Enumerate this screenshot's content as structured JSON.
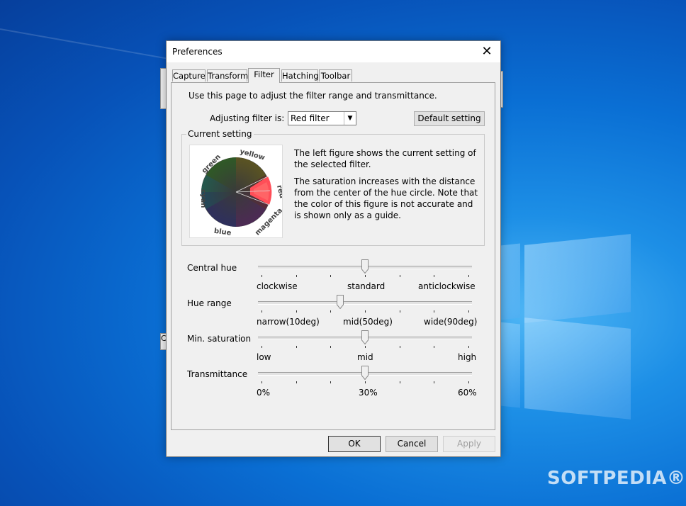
{
  "dialog": {
    "title": "Preferences",
    "close_glyph": "✕",
    "tabs": [
      "Capture",
      "Transform",
      "Filter",
      "Hatching",
      "Toolbar"
    ],
    "active_tab": "Filter"
  },
  "filter_page": {
    "intro": "Use this page to adjust the filter range and transmittance.",
    "adjusting_label": "Adjusting filter is:",
    "adjusting_value": "Red filter",
    "default_button": "Default setting",
    "group_title": "Current setting",
    "hue_labels": [
      "yellow",
      "green",
      "cyan",
      "blue",
      "magenta",
      "red"
    ],
    "desc1": "The left figure shows the current setting of the selected filter.",
    "desc2": "The saturation increases with the distance from the center of the hue circle. Note that the color of this figure is not accurate and is shown only as a guide."
  },
  "sliders": [
    {
      "label": "Central hue",
      "left": "clockwise",
      "mid": "standard",
      "right": "anticlockwise",
      "value": 0.5
    },
    {
      "label": "Hue range",
      "left": "narrow(10deg)",
      "mid": "mid(50deg)",
      "right": "wide(90deg)",
      "value": 0.38
    },
    {
      "label": "Min. saturation",
      "left": "low",
      "mid": "mid",
      "right": "high",
      "value": 0.5
    },
    {
      "label": "Transmittance",
      "left": "0%",
      "mid": "30%",
      "right": "60%",
      "value": 0.5
    }
  ],
  "buttons": {
    "ok": "OK",
    "cancel": "Cancel",
    "apply": "Apply"
  },
  "watermark": "SOFTPEDIA®",
  "bg_fragment": "C"
}
